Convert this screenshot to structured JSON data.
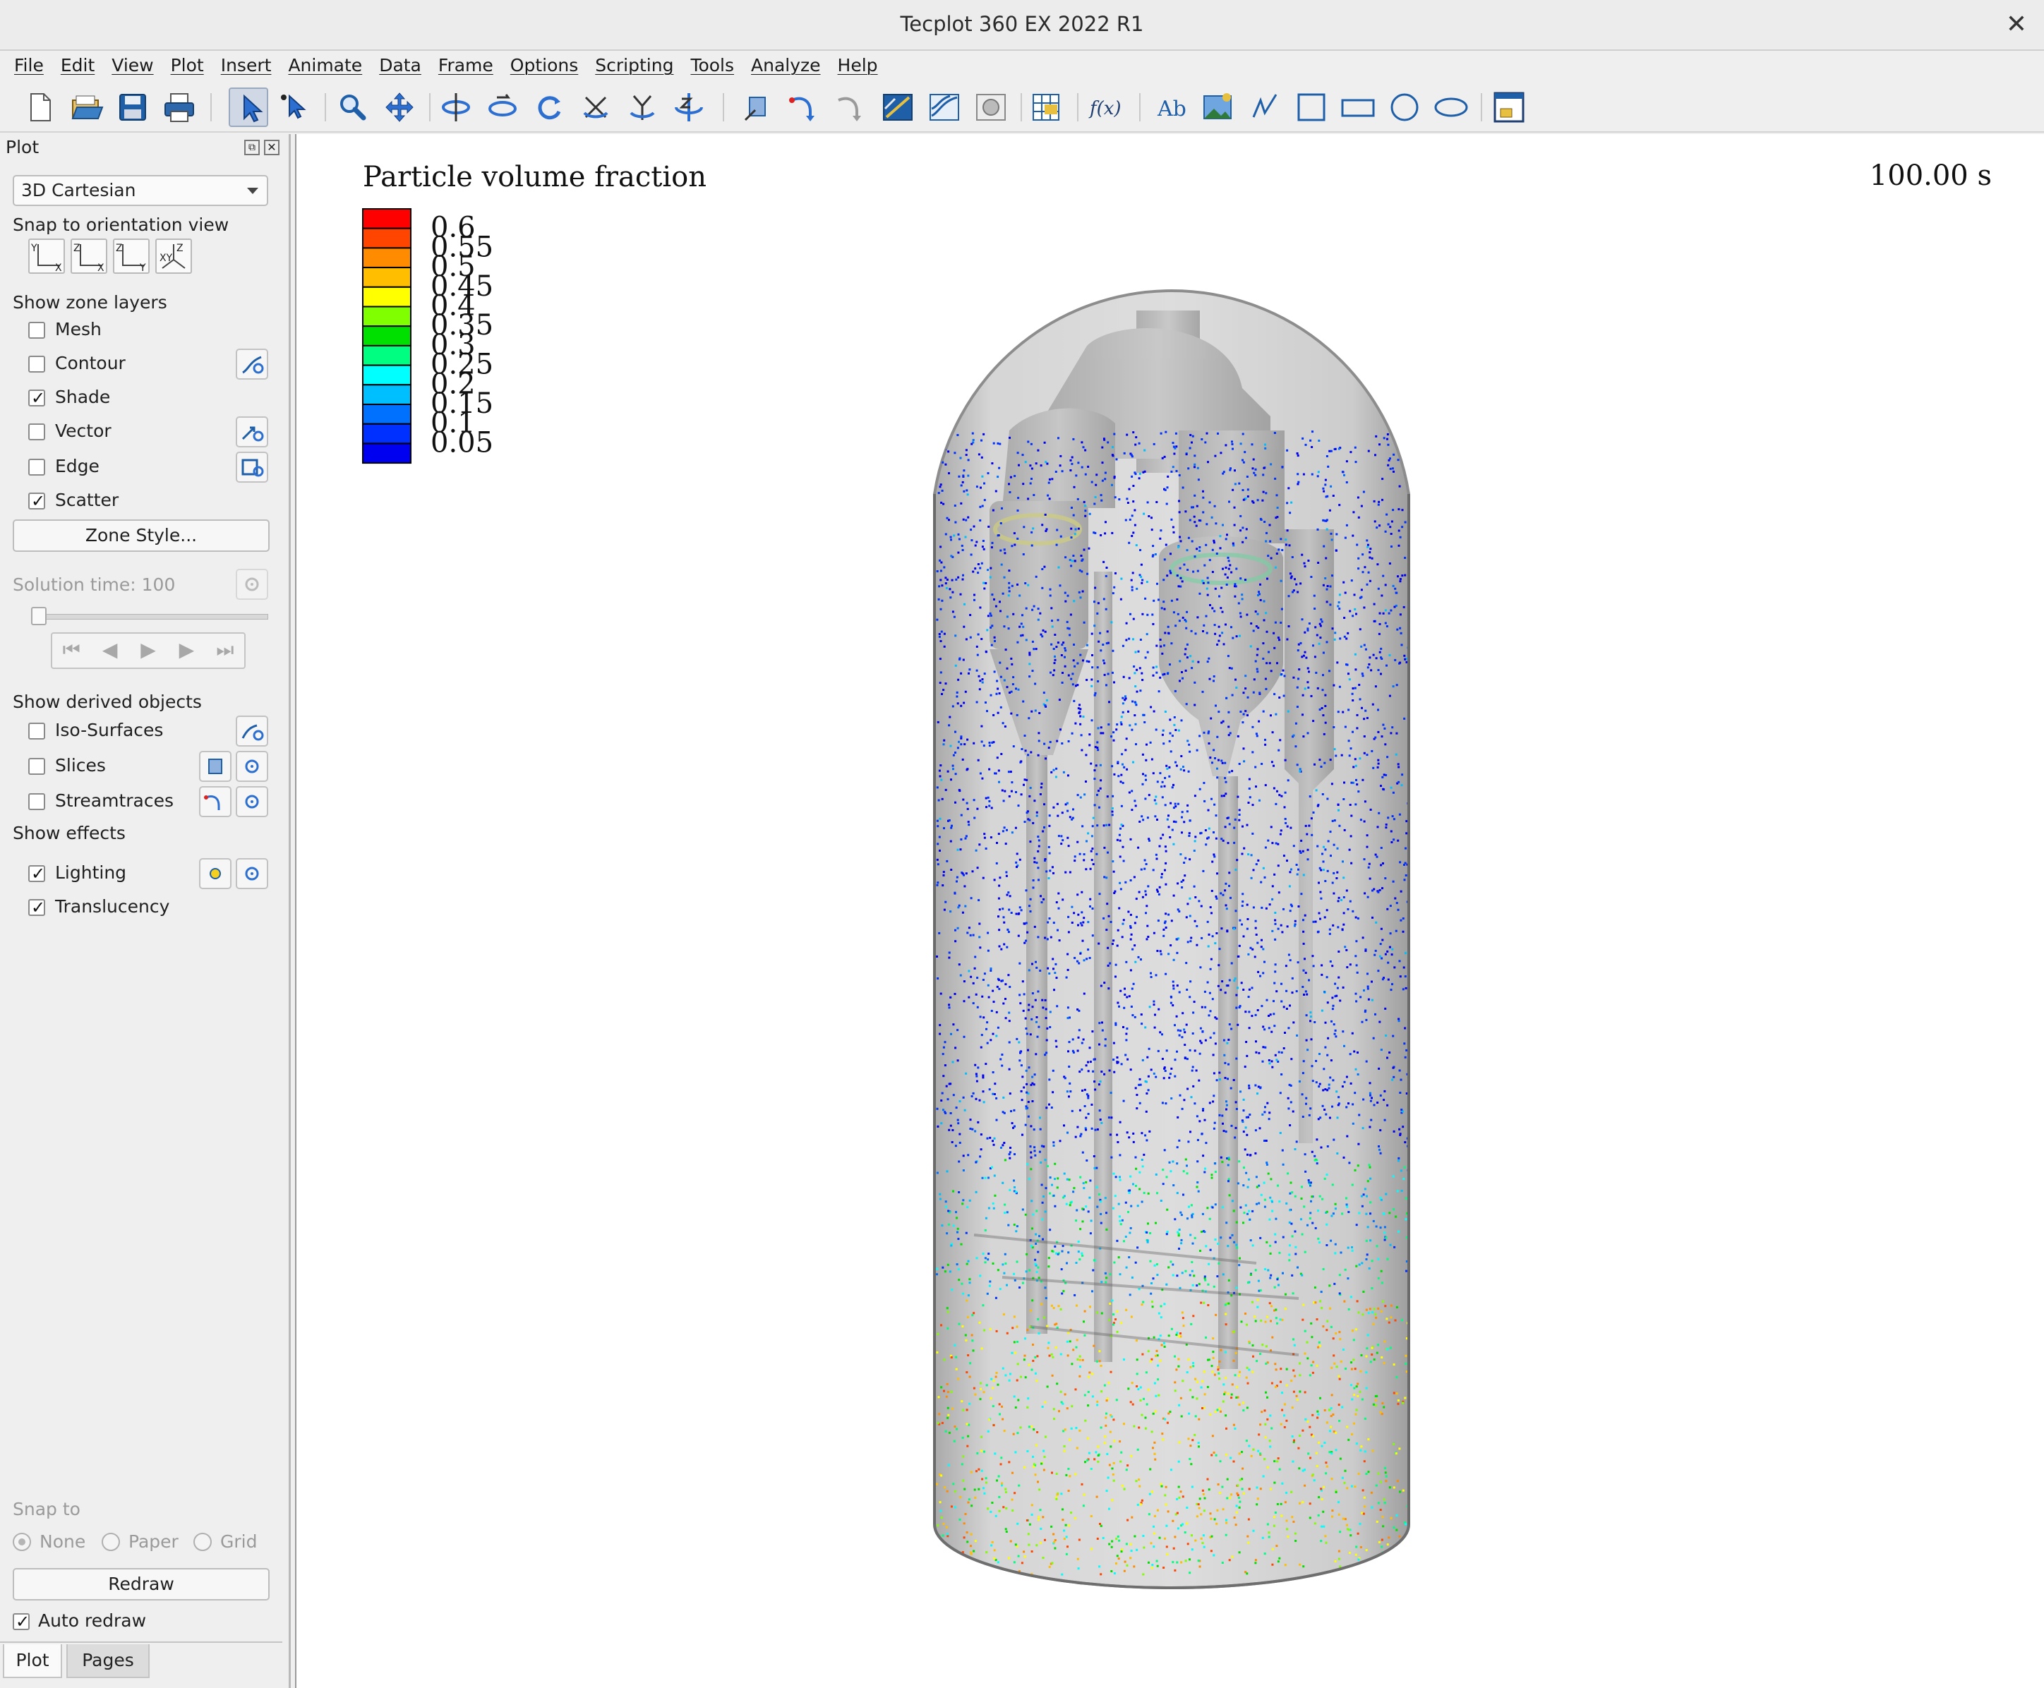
{
  "window": {
    "title": "Tecplot 360 EX 2022 R1",
    "close_glyph": "✕"
  },
  "menu": [
    "File",
    "Edit",
    "View",
    "Plot",
    "Insert",
    "Animate",
    "Data",
    "Frame",
    "Options",
    "Scripting",
    "Tools",
    "Analyze",
    "Help"
  ],
  "toolbar": {
    "icons": [
      "new-layout-icon",
      "open-file-icon",
      "save-icon",
      "print-icon",
      "select-icon",
      "adjustor-icon",
      "zoom-icon",
      "translate-icon",
      "rotate-spherical-icon",
      "rotate-rollerball-icon",
      "rotate-twist-icon",
      "rotate-x-icon",
      "rotate-y-icon",
      "rotate-z-icon",
      "probe-icon",
      "streamtrace-icon",
      "streamtrace-rake-icon",
      "slice-icon",
      "contour-icon",
      "isosurface-icon",
      "zone-select-icon",
      "equation-icon",
      "text-icon",
      "image-icon",
      "polyline-icon",
      "square-icon",
      "rectangle-icon",
      "circle-icon",
      "ellipse-icon",
      "frame-icon"
    ],
    "active": "select-icon"
  },
  "sidebar": {
    "title": "Plot",
    "plot_type": "3D Cartesian",
    "snap_orientation_label": "Snap to orientation view",
    "orientation_buttons": [
      {
        "top": "Y",
        "bottom": "X"
      },
      {
        "top": "Z",
        "bottom": "X"
      },
      {
        "top": "Z",
        "bottom": "Y"
      },
      {
        "top": "Z",
        "bottom": "XY"
      }
    ],
    "zone_layers_label": "Show zone layers",
    "zone_layers": [
      {
        "label": "Mesh",
        "checked": false
      },
      {
        "label": "Contour",
        "checked": false
      },
      {
        "label": "Shade",
        "checked": true
      },
      {
        "label": "Vector",
        "checked": false
      },
      {
        "label": "Edge",
        "checked": false
      },
      {
        "label": "Scatter",
        "checked": true
      }
    ],
    "zone_style_button": "Zone Style...",
    "solution_time_label": "Solution time: 100",
    "derived_label": "Show derived objects",
    "derived": [
      {
        "label": "Iso-Surfaces",
        "checked": false
      },
      {
        "label": "Slices",
        "checked": false
      },
      {
        "label": "Streamtraces",
        "checked": false
      }
    ],
    "effects_label": "Show effects",
    "effects": [
      {
        "label": "Lighting",
        "checked": true
      },
      {
        "label": "Translucency",
        "checked": true
      }
    ],
    "snap_to_label": "Snap to",
    "snap_options": [
      "None",
      "Paper",
      "Grid"
    ],
    "snap_selected": "None",
    "redraw_button": "Redraw",
    "auto_redraw_label": "Auto redraw",
    "auto_redraw_checked": true,
    "tabs": [
      "Plot",
      "Pages"
    ],
    "active_tab": "Plot"
  },
  "plot": {
    "legend_title": "Particle volume fraction",
    "legend_levels": [
      "0.6",
      "0.55",
      "0.5",
      "0.45",
      "0.4",
      "0.35",
      "0.3",
      "0.25",
      "0.2",
      "0.15",
      "0.1",
      "0.05"
    ],
    "legend_colors": [
      "#ff0000",
      "#ff4500",
      "#ff8c00",
      "#ffbf00",
      "#ffff00",
      "#80ff00",
      "#00e000",
      "#00ff80",
      "#00ffff",
      "#00bfff",
      "#0070ff",
      "#0030ff",
      "#0000f0"
    ],
    "time_label": "100.00 s"
  }
}
